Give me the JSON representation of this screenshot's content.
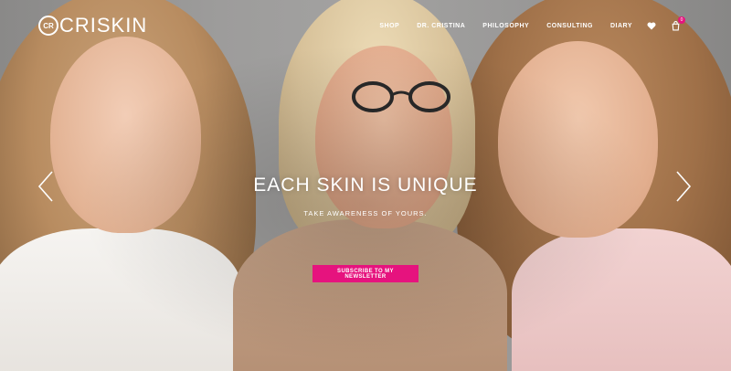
{
  "brand": {
    "mark": "CR",
    "name": "CRISKIN"
  },
  "nav": {
    "items": [
      "SHOP",
      "DR. CRISTINA",
      "PHILOSOPHY",
      "CONSULTING",
      "DIARY"
    ],
    "cart_count": "0"
  },
  "hero": {
    "headline": "EACH SKIN IS UNIQUE",
    "subline": "TAKE AWARENESS OF YOURS.",
    "cta_label": "SUBSCRIBE TO MY NEWSLETTER"
  },
  "colors": {
    "accent": "#e6137e",
    "text": "#ffffff"
  },
  "icons": [
    "heart-icon",
    "cart-icon",
    "chevron-left-icon",
    "chevron-right-icon"
  ]
}
